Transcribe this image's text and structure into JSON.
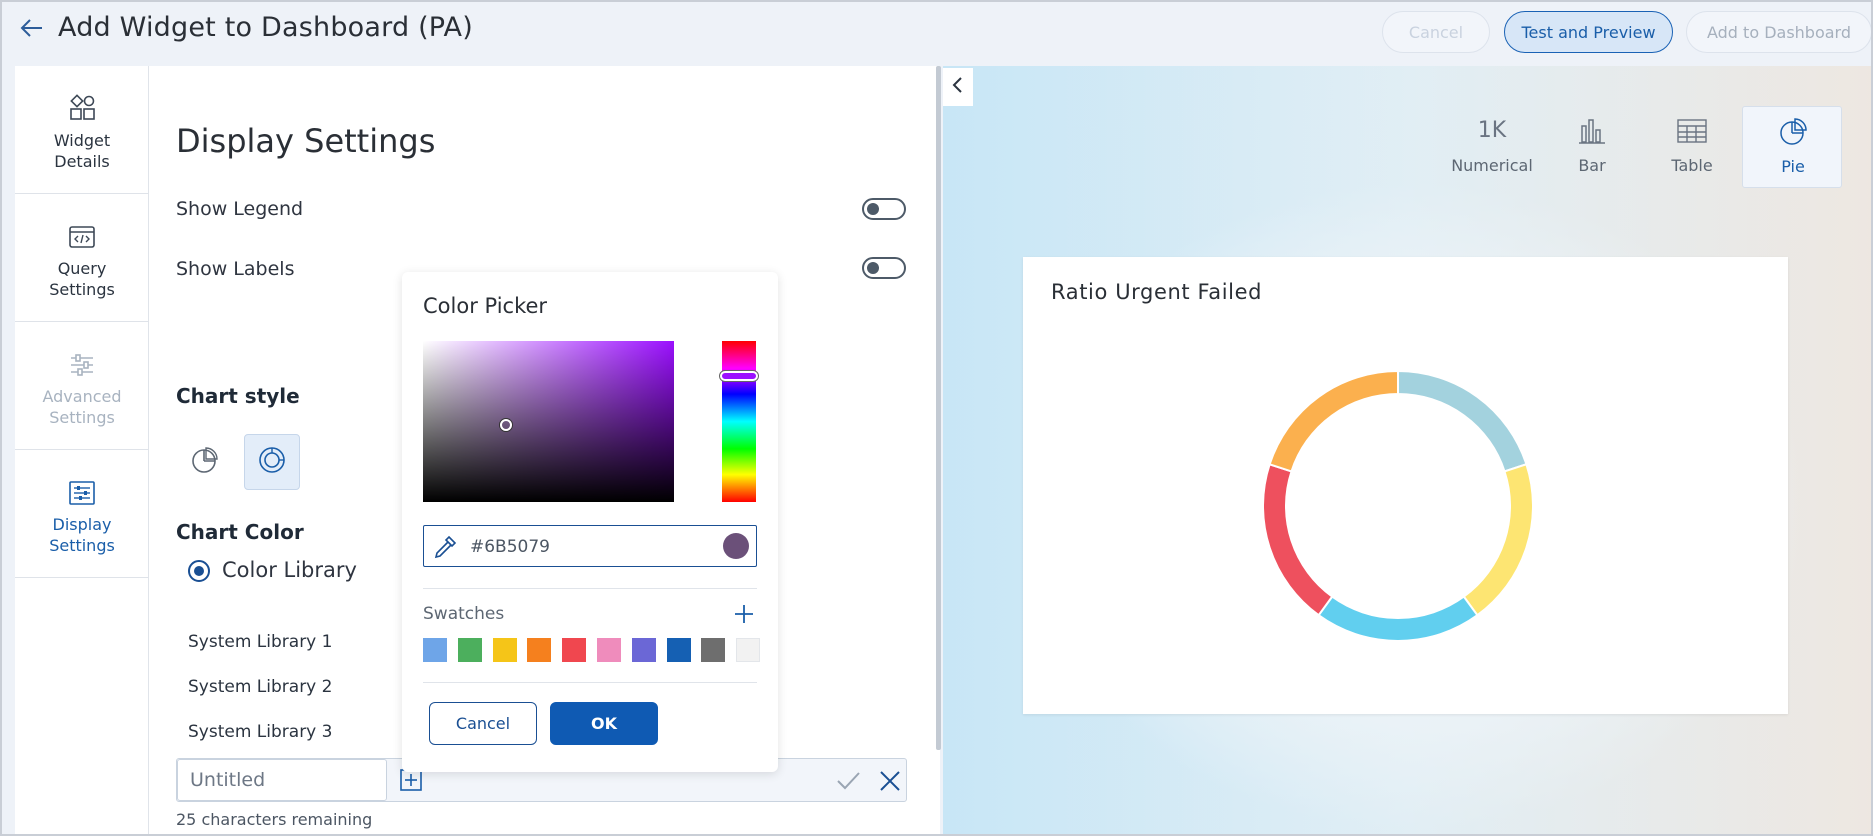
{
  "header": {
    "title": "Add Widget to Dashboard (PA)",
    "cancel_label": "Cancel",
    "test_preview_label": "Test and Preview",
    "add_label": "Add to Dashboard"
  },
  "nav": {
    "widget_details": [
      "Widget",
      "Details"
    ],
    "query_settings": [
      "Query",
      "Settings"
    ],
    "advanced_settings": [
      "Advanced",
      "Settings"
    ],
    "display_settings": [
      "Display",
      "Settings"
    ]
  },
  "display_settings": {
    "title": "Display Settings",
    "show_legend": "Show Legend",
    "show_legend_on": false,
    "show_labels": "Show Labels",
    "show_labels_on": false,
    "chart_style_heading": "Chart style",
    "chart_color_heading": "Chart Color",
    "color_library_label": "Color Library",
    "libraries": [
      "System Library 1",
      "System Library 2",
      "System Library 3"
    ],
    "library_name_placeholder": "Untitled",
    "chars_remaining": "25 characters remaining"
  },
  "color_picker": {
    "title": "Color Picker",
    "hex": "#6B5079",
    "swatches_label": "Swatches",
    "swatches": [
      "#6ea5e8",
      "#4caf5d",
      "#f5c518",
      "#f5801e",
      "#f0474f",
      "#ef8cbc",
      "#6b67d6",
      "#1560b3",
      "#6e6e6e",
      "#f2f2f2"
    ],
    "cancel_label": "Cancel",
    "ok_label": "OK"
  },
  "preview": {
    "chart_types": [
      {
        "icon": "1K",
        "label": "Numerical"
      },
      {
        "icon": "bar-chart-icon",
        "label": "Bar"
      },
      {
        "icon": "table-icon",
        "label": "Table"
      },
      {
        "icon": "pie-chart-icon",
        "label": "Pie"
      }
    ],
    "selected_type": "Pie"
  },
  "chart_data": {
    "type": "pie",
    "title": "Ratio Urgent Failed",
    "style": "donut",
    "legend": false,
    "slices": [
      {
        "value": 1,
        "color": "#a3d2de"
      },
      {
        "value": 1,
        "color": "#fde572"
      },
      {
        "value": 1,
        "color": "#61cfef"
      },
      {
        "value": 1,
        "color": "#ee505e"
      },
      {
        "value": 1,
        "color": "#fbb04e"
      }
    ]
  }
}
